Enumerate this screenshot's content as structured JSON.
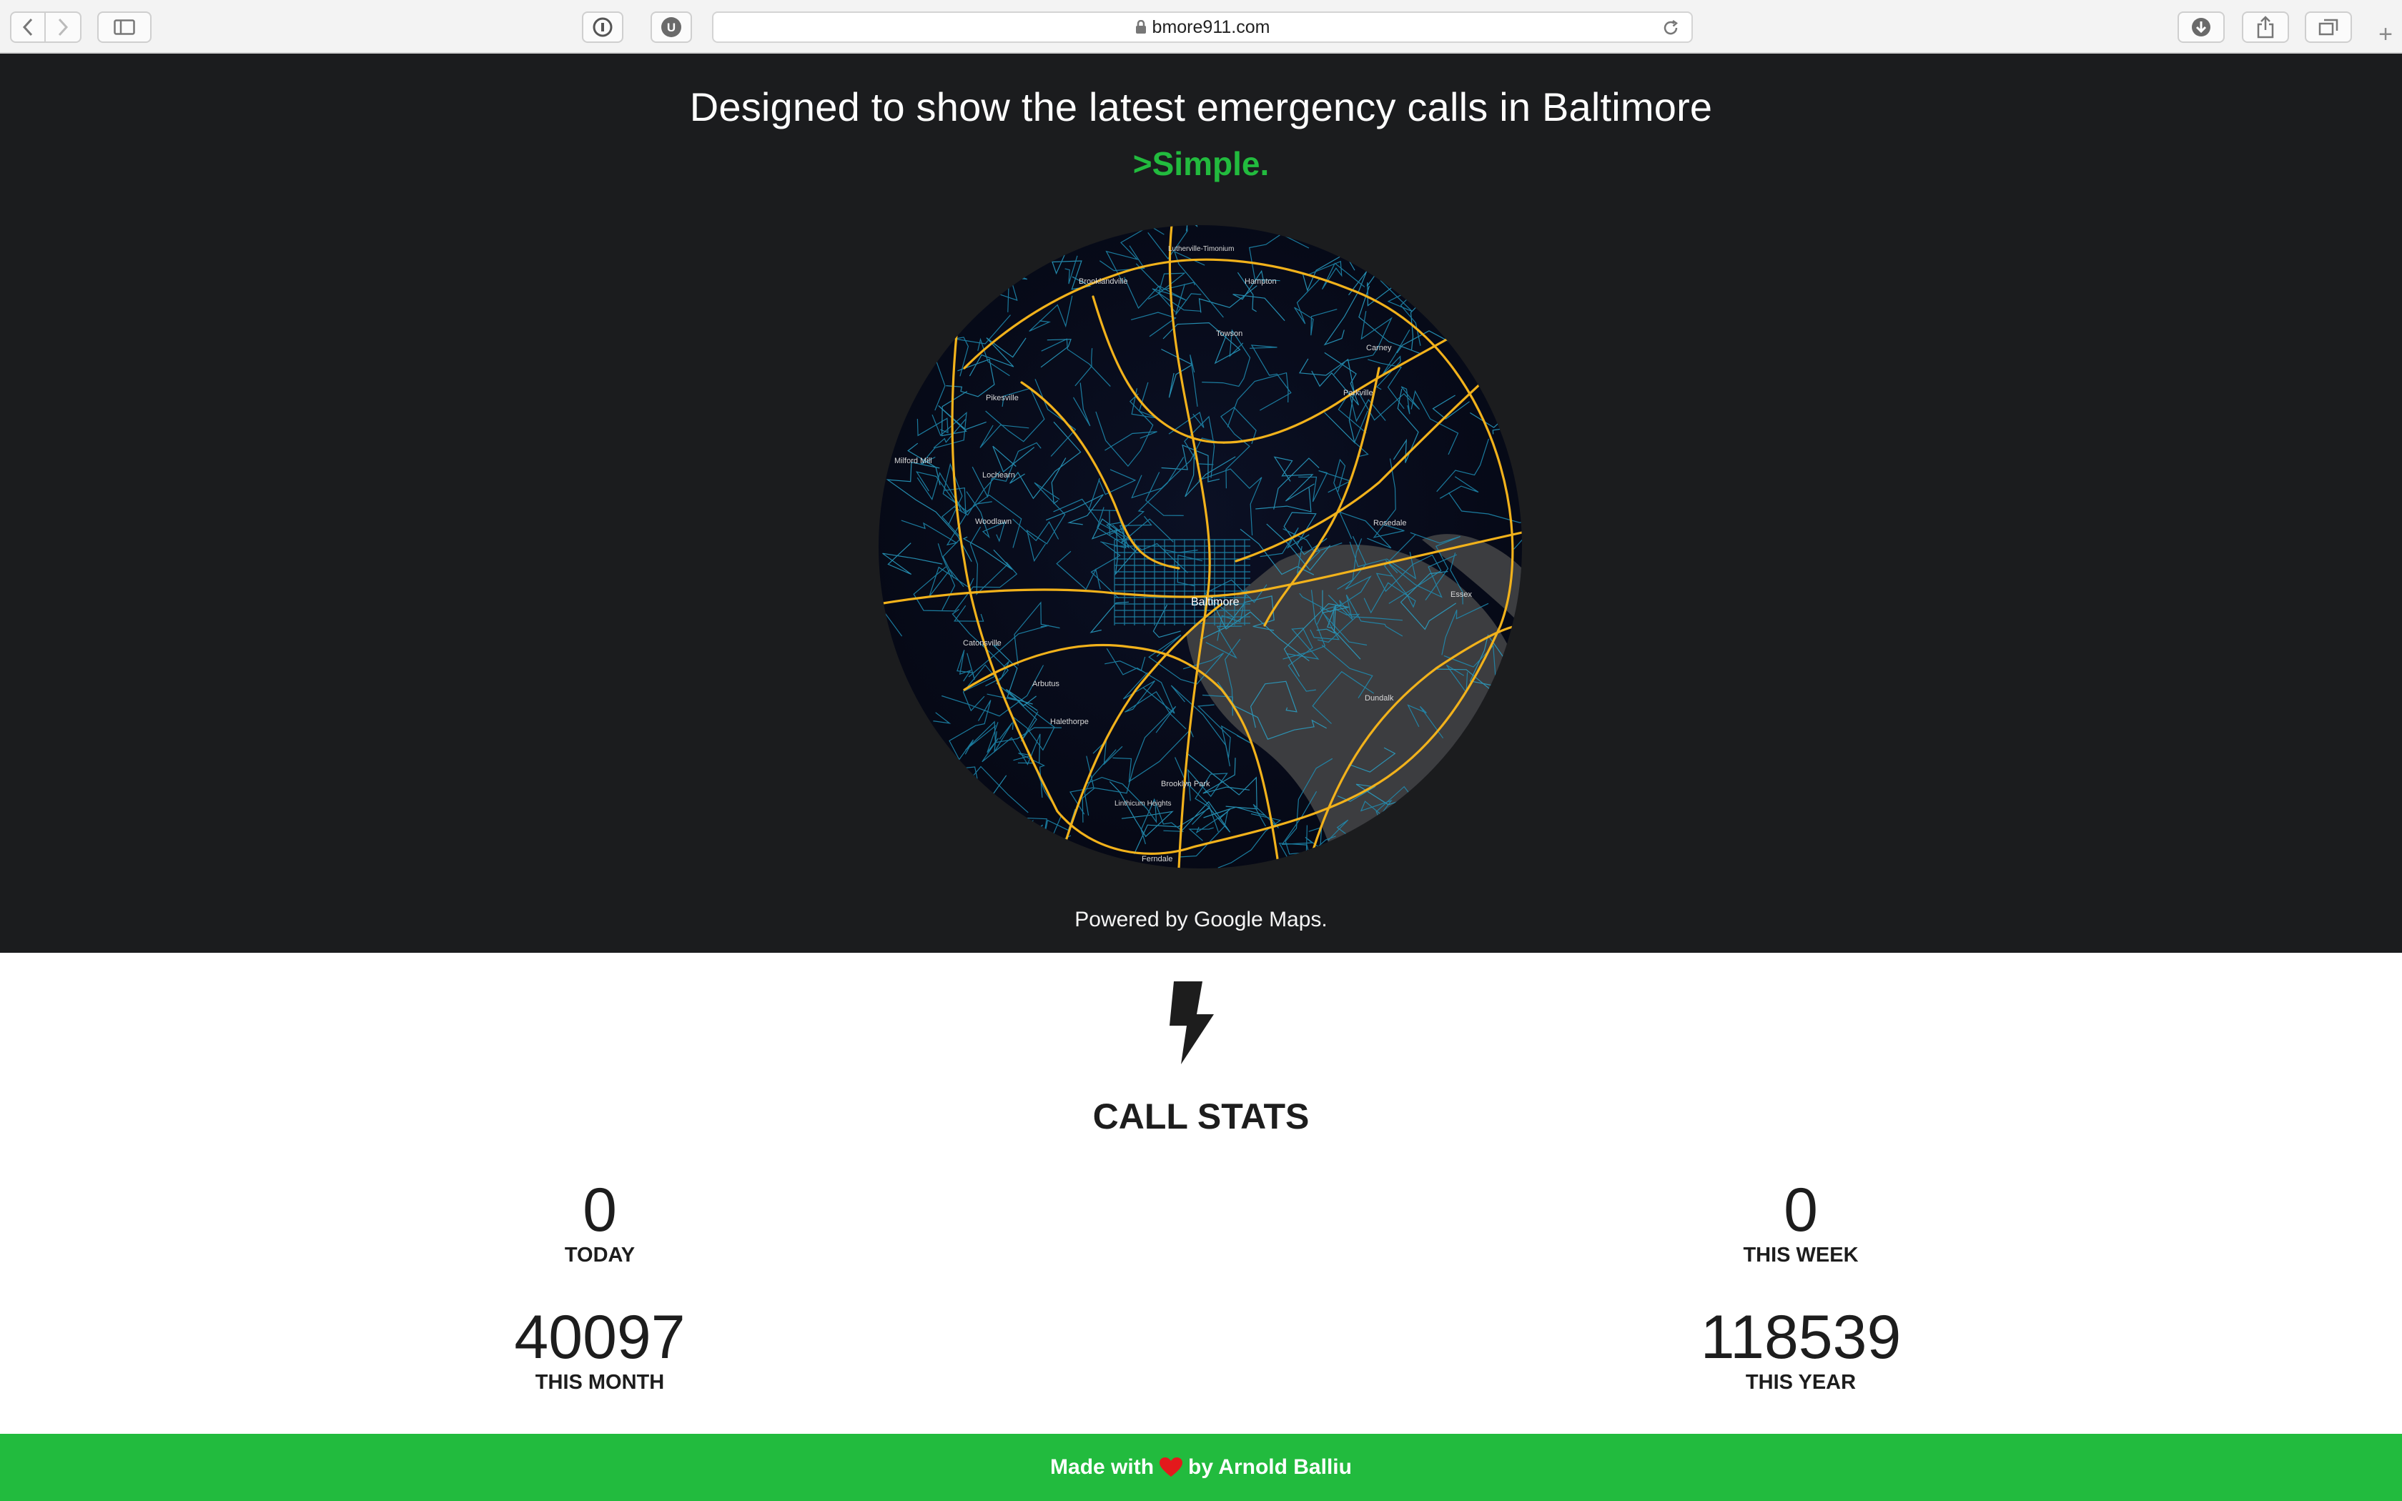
{
  "browser": {
    "url": "bmore911.com"
  },
  "hero": {
    "title": "Designed to show the latest emergency calls in Baltimore",
    "subtitle": ">Simple.",
    "powered_by": "Powered by Google Maps."
  },
  "map": {
    "labels": {
      "center": "Baltimore",
      "towson": "Towson",
      "pikesville": "Pikesville",
      "woodlawn": "Woodlawn",
      "catonsville": "Catonsville",
      "dundalk": "Dundalk",
      "parkville": "Parkville",
      "hampton": "Hampton",
      "brooklandville": "Brooklandville",
      "carney": "Carney",
      "rosedale": "Rosedale",
      "arbutus": "Arbutus",
      "lutherville": "Lutherville-Timonium",
      "milford_mill": "Milford Mill",
      "lochearn": "Lochearn",
      "essex": "Essex",
      "halethorpe": "Halethorpe",
      "linthicum": "Linthicum Heights",
      "ferndale": "Ferndale",
      "brooklyn_park": "Brooklyn Park"
    }
  },
  "stats": {
    "icon": "bolt-icon",
    "title": "CALL STATS",
    "today": {
      "value": "0",
      "label": "TODAY"
    },
    "week": {
      "value": "0",
      "label": "THIS WEEK"
    },
    "month": {
      "value": "40097",
      "label": "THIS MONTH"
    },
    "year": {
      "value": "118539",
      "label": "THIS YEAR"
    }
  },
  "footer": {
    "made_with": "Made with",
    "by": "by Arnold Balliu",
    "heart_icon": "heart-icon"
  },
  "colors": {
    "hero_bg": "#1b1c1e",
    "accent_green": "#22bb3e",
    "map_highway": "#f2b21b",
    "map_road": "#1f8fb5",
    "heart": "#e3191c"
  }
}
